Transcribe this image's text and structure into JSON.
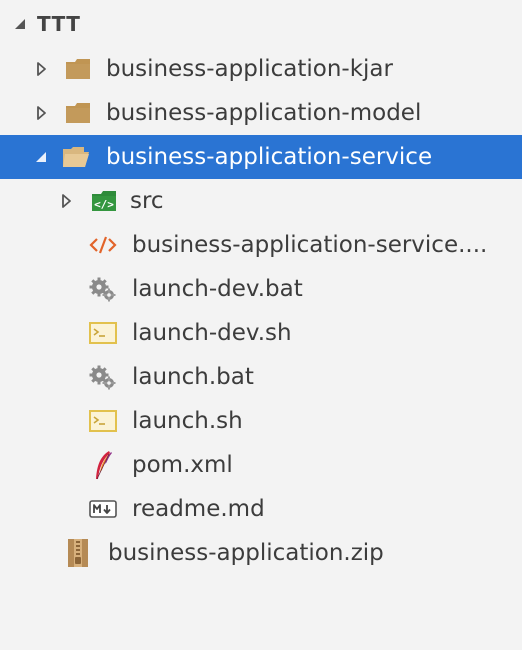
{
  "explorer": {
    "root": {
      "label": "TTT",
      "expanded": true
    },
    "items": [
      {
        "label": "business-application-kjar",
        "icon": "folder-icon",
        "expanded": false,
        "selected": false
      },
      {
        "label": "business-application-model",
        "icon": "folder-icon",
        "expanded": false,
        "selected": false
      },
      {
        "label": "business-application-service",
        "icon": "folder-open-icon",
        "expanded": true,
        "selected": true,
        "children": [
          {
            "label": "src",
            "icon": "source-folder-icon",
            "expanded": false
          },
          {
            "label": "business-application-service....",
            "icon": "xml-code-icon"
          },
          {
            "label": "launch-dev.bat",
            "icon": "gear-icon"
          },
          {
            "label": "launch-dev.sh",
            "icon": "terminal-icon"
          },
          {
            "label": "launch.bat",
            "icon": "gear-icon"
          },
          {
            "label": "launch.sh",
            "icon": "terminal-icon"
          },
          {
            "label": "pom.xml",
            "icon": "maven-feather-icon"
          },
          {
            "label": "readme.md",
            "icon": "markdown-icon"
          }
        ]
      },
      {
        "label": "business-application.zip",
        "icon": "zip-archive-icon"
      }
    ]
  },
  "colors": {
    "selection": "#2a74d3",
    "background": "#f3f3f3",
    "folder": "#c09553",
    "source_folder": "#2e8b3a",
    "xml": "#e2642a",
    "terminal": "#e2c14d",
    "zip": "#a97f4f"
  }
}
